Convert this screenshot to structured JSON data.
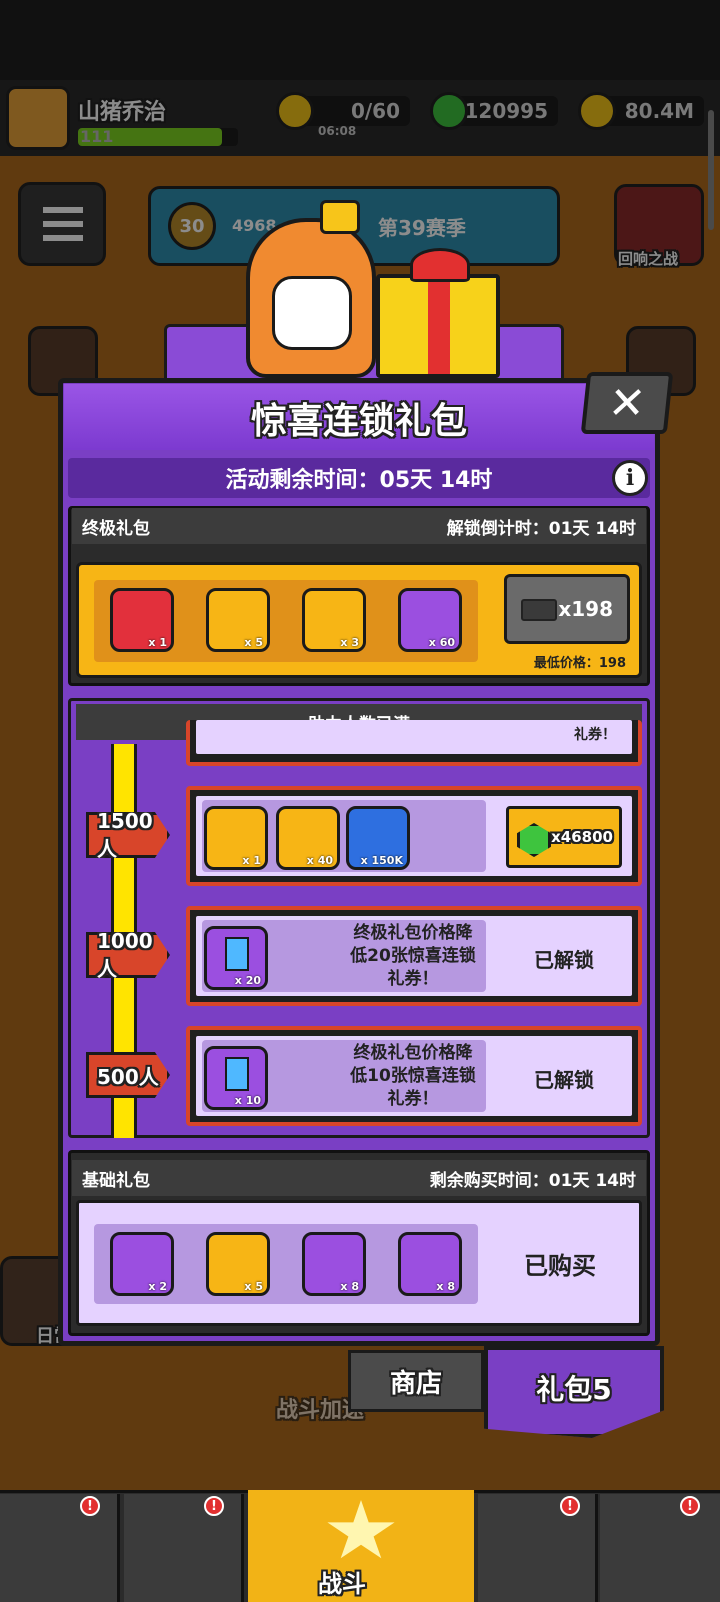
{
  "player": {
    "name": "山猪乔治",
    "level": "111"
  },
  "resources": {
    "energy": "0/60",
    "energy_timer": "06:08",
    "gems": "120995",
    "coins": "80.4M"
  },
  "season": {
    "rank": "30",
    "progress": "4968",
    "label": "第39赛季"
  },
  "background": {
    "echo_battle": "回响之战",
    "daily_challenge": "日常挑战",
    "battle_boost": "战斗加速",
    "battle": "战斗"
  },
  "modal": {
    "title": "惊喜连锁礼包",
    "time_left": "活动剩余时间：05天 14时",
    "info_icon": "i",
    "close_icon": "✕"
  },
  "ultimate": {
    "title": "终极礼包",
    "countdown": "解锁倒计时：01天 14时",
    "items": [
      {
        "icon": "red-chest-icon",
        "qty": "x 1",
        "color": "#e2303c"
      },
      {
        "icon": "gold-chest-icon",
        "qty": "x 5",
        "color": "#f7b515"
      },
      {
        "icon": "gear-chest-icon",
        "qty": "x 3",
        "color": "#f7b515"
      },
      {
        "icon": "key-icon",
        "qty": "x 60",
        "color": "#9b4fe0"
      }
    ],
    "price": "x198",
    "min_price": "最低价格：198"
  },
  "help": {
    "header": "助力人数已满",
    "partial_text": "礼券！",
    "tiers": [
      {
        "badge": "1500人",
        "items": [
          {
            "icon": "diamond-chest-icon",
            "qty": "x 1",
            "color": "#f7b515"
          },
          {
            "icon": "gear-weapon-icon",
            "qty": "x 40",
            "color": "#f7b515"
          },
          {
            "icon": "lion-coin-icon",
            "qty": "x 150K",
            "color": "#2e6fe0"
          }
        ],
        "price": "x46800"
      },
      {
        "badge": "1000人",
        "items": [
          {
            "icon": "discount-voucher-icon",
            "qty": "x 20",
            "color": "#9b4fe0"
          }
        ],
        "desc": [
          "终极礼包价格降",
          "低20张惊喜连锁",
          "礼券！"
        ],
        "status": "已解锁"
      },
      {
        "badge": "500人",
        "items": [
          {
            "icon": "discount-voucher-icon",
            "qty": "x 10",
            "color": "#9b4fe0"
          }
        ],
        "desc": [
          "终极礼包价格降",
          "低10张惊喜连锁",
          "礼券！"
        ],
        "status": "已解锁"
      }
    ]
  },
  "basic": {
    "title": "基础礼包",
    "countdown": "剩余购买时间：01天 14时",
    "items": [
      {
        "icon": "emblem-icon",
        "qty": "x 2",
        "color": "#9b4fe0"
      },
      {
        "icon": "gear-chest-icon",
        "qty": "x 5",
        "color": "#f7b515"
      },
      {
        "icon": "key-icon",
        "qty": "x 8",
        "color": "#9b4fe0"
      },
      {
        "icon": "key-icon",
        "qty": "x 8",
        "color": "#9b4fe0"
      }
    ],
    "status": "已购买"
  },
  "tabs": {
    "shop": "商店",
    "gift": "礼包5"
  },
  "colors": {
    "purple": "#7a3fc4",
    "gold": "#f7b515",
    "red": "#d8452a",
    "yellow_rail": "#ffe400"
  }
}
